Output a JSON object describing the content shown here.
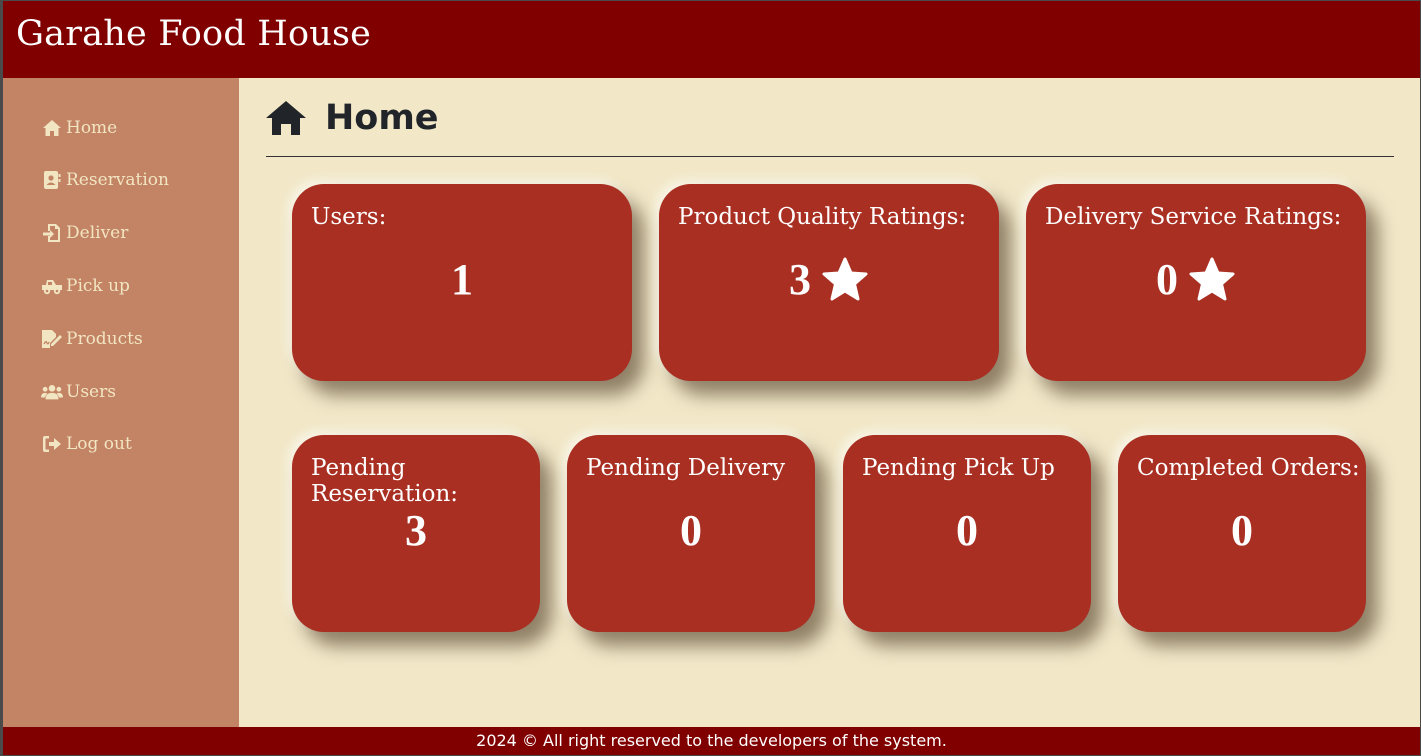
{
  "header": {
    "title": "Garahe Food House"
  },
  "sidebar": {
    "items": [
      {
        "label": "Home",
        "icon": "home-icon"
      },
      {
        "label": "Reservation",
        "icon": "address-card-icon"
      },
      {
        "label": "Deliver",
        "icon": "file-import-icon"
      },
      {
        "label": "Pick up",
        "icon": "truck-pickup-icon"
      },
      {
        "label": "Products",
        "icon": "file-signature-icon"
      },
      {
        "label": "Users",
        "icon": "users-icon"
      },
      {
        "label": "Log out",
        "icon": "sign-out-icon"
      }
    ]
  },
  "main": {
    "title": "Home",
    "title_icon": "home-icon",
    "stats": [
      {
        "label": "Users:",
        "value": "1"
      },
      {
        "label": "Product Quality Ratings:",
        "value": "3",
        "icon": "star-icon"
      },
      {
        "label": "Delivery Service Ratings:",
        "value": "0",
        "icon": "star-icon"
      },
      {
        "label": "Pending Reservation:",
        "value": "3"
      },
      {
        "label": "Pending Delivery",
        "value": "0"
      },
      {
        "label": "Pending Pick Up",
        "value": "0"
      },
      {
        "label": "Completed Orders:",
        "value": "0"
      }
    ]
  },
  "footer": {
    "text": "2024 © All right reserved to the developers of the system."
  },
  "colors": {
    "header_bg": "#800000",
    "sidebar_bg": "#c28465",
    "content_bg": "#f2e8c8",
    "card_bg": "#a82f22",
    "nav_text": "#f2e5c2"
  }
}
